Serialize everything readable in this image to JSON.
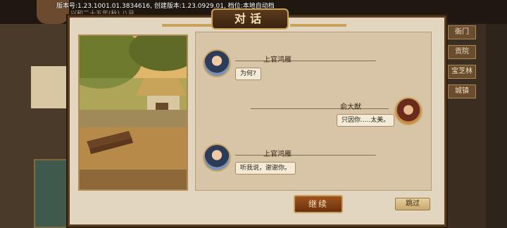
{
  "version_line": "版本号:1.23.1001.01.3834616, 创建版本:1.23.0929.01, 档位:本地自动档",
  "background": {
    "date_text": "兴和二十五年(秋) 八月",
    "right_menu": [
      "衙门",
      "贡院",
      "宝芝林",
      "城镇"
    ]
  },
  "dialog": {
    "title": "对话",
    "messages": [
      {
        "speaker": "上官鸿雁",
        "text": "为何?",
        "side": "left"
      },
      {
        "speaker": "俞大猷",
        "text": "只因你.....太美。",
        "side": "right"
      },
      {
        "speaker": "上官鸿雁",
        "text": "听我说，谢谢你。",
        "side": "left"
      }
    ],
    "continue_label": "继续",
    "skip_label": "跳过"
  },
  "colors": {
    "dialog_bg": "#e3d6c1",
    "frame": "#5a3b1e",
    "accent_gold": "#c9a35e",
    "continue_btn": "#8a4318"
  }
}
